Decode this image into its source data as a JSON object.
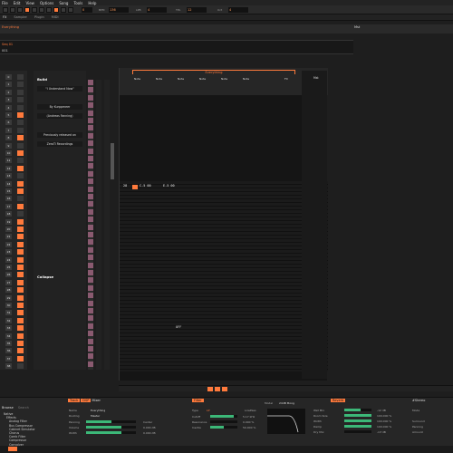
{
  "menu": [
    "File",
    "Edit",
    "View",
    "Options",
    "Song",
    "Tools",
    "Help"
  ],
  "toolbar": {
    "bpm_label": "BPM",
    "bpm": "136",
    "lpb_label": "LPB",
    "lpb": "4",
    "tpl_label": "TPL",
    "tpl": "12",
    "oct_label": "Oct",
    "oct": "4",
    "pattern_num": "0"
  },
  "tabs": {
    "fx": "FX",
    "sampler": "Sampler",
    "plugin": "Plugin",
    "midi": "MIDI"
  },
  "sequencer": {
    "track": "Everything",
    "master": "Mst"
  },
  "mini": {
    "title": "Seq 01",
    "value": "001"
  },
  "rows": [
    "0",
    "1",
    "2",
    "3",
    "4",
    "5",
    "6",
    "7",
    "8",
    "9",
    "10",
    "11",
    "12",
    "13",
    "14",
    "15",
    "16",
    "17",
    "18",
    "19",
    "20",
    "21",
    "22",
    "23",
    "24",
    "25",
    "26",
    "27",
    "28",
    "29",
    "30",
    "31",
    "32",
    "33",
    "34",
    "35",
    "36",
    "37",
    "38"
  ],
  "textpanel": {
    "title1": "Build",
    "b1": "\"I Understand Now\"",
    "b2": "By Kurppmeer",
    "b3": "(Andreas Fanning)",
    "b4": "Previously released on",
    "b5": "ZeroTi Recordings",
    "title2": "Collapse"
  },
  "pattern": {
    "track": "Everything",
    "cols": [
      "Note",
      "Note",
      "Note",
      "Note",
      "Note",
      "Note",
      "FX"
    ],
    "vol": "Vol",
    "current_row": "28",
    "note1": "C-5 00",
    "note2": "E-5 00",
    "off": "OFF"
  },
  "bottom": {
    "browser_tab": "Browse",
    "search_placeholder": "Search",
    "tree": [
      "Native",
      "Effects",
      "Analog Filter",
      "Bus Compressor",
      "Cabinet Simulator",
      "Chorus",
      "Comb Filter",
      "Compressor",
      "Convolver"
    ],
    "track_tab": "Track",
    "dsp_tab": "DSP",
    "mix_tab": "Mixer",
    "name_label": "Name",
    "name_value": "Everything",
    "routing_label": "Routing",
    "routing_value": "Master",
    "panning_label": "Panning",
    "panning_value": "Center",
    "volume_label": "Volume",
    "volume_value": "0.000 dB",
    "width_label": "Width",
    "width_value": "0.000 dB",
    "filter_title": "Filter",
    "type_label": "Type",
    "lp_label": "LP",
    "lp_value": "LowPass",
    "cutoff_label": "Cutoff",
    "cutoff_value": "5.17 kHz",
    "res_label": "Resonance",
    "res_value": "0.000 %",
    "inertia_label": "Inertia",
    "inertia_value": "50.000 %",
    "model_label": "Model",
    "model_value": "24dB Moog",
    "reverb_title": "Reverb",
    "roomsize_label": "Room Size",
    "roomsize_value": "100.000 %",
    "damp_label": "Damp",
    "damp_value": "100.000 %",
    "wet_label": "Wet Mix",
    "wet_value": "-12 dB",
    "widthr_label": "Width",
    "widthr_value": "100.000 %",
    "dry_label": "Dry Mix",
    "dry_value": "-inf dB",
    "stereo_title": "#Stereo",
    "mode_label": "Mode",
    "surround_label": "Surround",
    "panning2_label": "Panning",
    "amount_label": "Amount"
  },
  "colors": {
    "accent": "#ff7a3c",
    "bg": "#1e1e1e",
    "green": "#3cb878"
  }
}
